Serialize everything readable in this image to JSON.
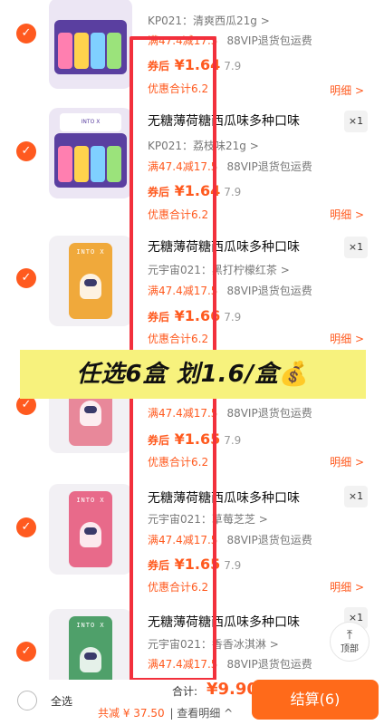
{
  "items": [
    {
      "title": "",
      "variant": "KP021：清爽西瓜21g >",
      "promo_tag": "满47.4减17.5",
      "promo_note": "88VIP退货包运费",
      "after_label": "券后",
      "after_amount": "¥1.64",
      "orig_price": "7.9",
      "total_note": "优惠合计6.2",
      "detail": "明细 >",
      "qty": ""
    },
    {
      "title": "无糖薄荷糖西瓜味多种口味",
      "variant": "KP021：荔枝味21g >",
      "promo_tag": "满47.4减17.5",
      "promo_note": "88VIP退货包运费",
      "after_label": "券后",
      "after_amount": "¥1.64",
      "orig_price": "7.9",
      "total_note": "优惠合计6.2",
      "detail": "明细 >",
      "qty": "×1"
    },
    {
      "title": "无糖薄荷糖西瓜味多种口味",
      "variant": "元宇宙021：黑打柠檬红茶 >",
      "promo_tag": "满47.4减17.5",
      "promo_note": "88VIP退货包运费",
      "after_label": "券后",
      "after_amount": "¥1.66",
      "orig_price": "7.9",
      "total_note": "优惠合计6.2",
      "detail": "明细 >",
      "qty": "×1"
    },
    {
      "title": "",
      "variant": "",
      "promo_tag": "满47.4减17.5",
      "promo_note": "88VIP退货包运费",
      "after_label": "券后",
      "after_amount": "¥1.65",
      "orig_price": "7.9",
      "total_note": "优惠合计6.2",
      "detail": "明细 >",
      "qty": ""
    },
    {
      "title": "无糖薄荷糖西瓜味多种口味",
      "variant": "元宇宙021：草莓芝芝 >",
      "promo_tag": "满47.4减17.5",
      "promo_note": "88VIP退货包运费",
      "after_label": "券后",
      "after_amount": "¥1.65",
      "orig_price": "7.9",
      "total_note": "优惠合计6.2",
      "detail": "明细 >",
      "qty": "×1"
    },
    {
      "title": "无糖薄荷糖西瓜味多种口味",
      "variant": "元宇宙021：香香冰淇淋 >",
      "promo_tag": "满47.4减17.5",
      "promo_note": "88VIP退货包运费",
      "after_label": "",
      "after_amount": "",
      "orig_price": "",
      "total_note": "",
      "detail": "",
      "qty": "×1"
    }
  ],
  "overlay_text": "任选6盒 划1.6/盒",
  "overlay_emoji": "💰",
  "back_to_top": {
    "arrow": "⤒",
    "label": "顶部"
  },
  "footer": {
    "select_all": "全选",
    "total_label": "合计:",
    "total_value": "¥9.90",
    "savings": "共减 ¥ 37.50",
    "view_detail": "| 查看明细 ^",
    "checkout": "结算(6)"
  },
  "colors": {
    "accent": "#ff5a1f",
    "checkout_bg": "#ff6a1a",
    "highlight_border": "#f2303c",
    "overlay_bg": "#f7f27d"
  }
}
